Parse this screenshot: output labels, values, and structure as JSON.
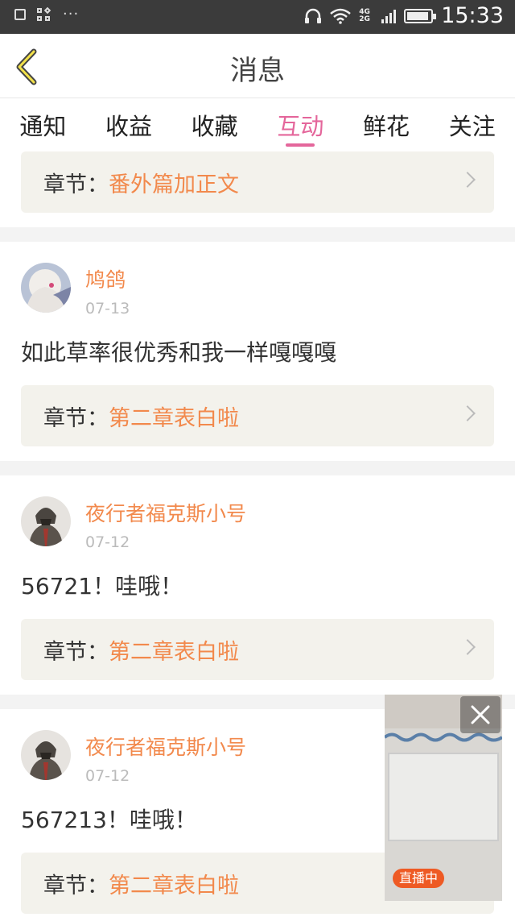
{
  "statusbar": {
    "time": "15:33",
    "network": "4G 2G",
    "dots": "···"
  },
  "header": {
    "title": "消息"
  },
  "tabs": [
    {
      "label": "通知",
      "active": false
    },
    {
      "label": "收益",
      "active": false
    },
    {
      "label": "收藏",
      "active": false
    },
    {
      "label": "互动",
      "active": true
    },
    {
      "label": "鲜花",
      "active": false
    },
    {
      "label": "关注",
      "active": false
    }
  ],
  "chapter_label": "章节：",
  "items": [
    {
      "chapter": "番外篇加正文"
    },
    {
      "user": "鸠鸽",
      "date": "07-13",
      "comment": "如此草率很优秀和我一样嘎嘎嘎",
      "chapter": "第二章表白啦"
    },
    {
      "user": "夜行者福克斯小号",
      "date": "07-12",
      "comment": "56721！哇哦！",
      "chapter": "第二章表白啦"
    },
    {
      "user": "夜行者福克斯小号",
      "date": "07-12",
      "comment": "567213！哇哦！",
      "chapter": "第二章表白啦"
    }
  ],
  "live": {
    "badge": "直播中"
  },
  "colors": {
    "accent_pink": "#e4669b",
    "orange": "#f2894c",
    "statusbar": "#3b3b3b"
  }
}
